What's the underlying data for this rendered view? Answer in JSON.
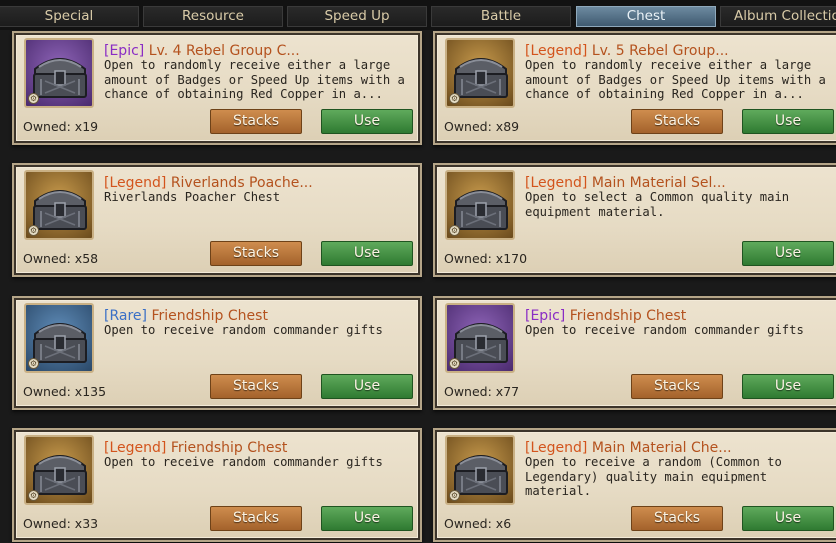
{
  "tabs": [
    "Special",
    "Resource",
    "Speed Up",
    "Battle",
    "Chest",
    "Album Collection"
  ],
  "active_tab": "Chest",
  "buttons": {
    "stacks": "Stacks",
    "use": "Use"
  },
  "items": [
    {
      "rarity": "[Epic]",
      "rarity_class": "epic",
      "name": "Lv. 4 Rebel Group C...",
      "desc": "Open to randomly receive either a large amount of Badges or Speed Up items with a chance of obtaining Red Copper in a...",
      "owned": "Owned: x19",
      "has_stacks": true,
      "icon": "chest-icon"
    },
    {
      "rarity": "[Legend]",
      "rarity_class": "legend",
      "name": "Lv. 5 Rebel Group...",
      "desc": "Open to randomly receive either a large amount of Badges or Speed Up items with a chance of obtaining Red Copper in a...",
      "owned": "Owned: x89",
      "has_stacks": true,
      "icon": "chest-icon"
    },
    {
      "rarity": "[Legend]",
      "rarity_class": "legend",
      "name": "Riverlands Poache...",
      "desc": "Riverlands Poacher Chest",
      "owned": "Owned: x58",
      "has_stacks": true,
      "icon": "chest-icon"
    },
    {
      "rarity": "[Legend]",
      "rarity_class": "legend",
      "name": "Main Material Sel...",
      "desc": "Open to select a Common quality main equipment material.",
      "owned": "Owned: x170",
      "has_stacks": false,
      "icon": "chest-icon"
    },
    {
      "rarity": "[Rare]",
      "rarity_class": "rare",
      "name": "Friendship Chest",
      "desc": "Open to receive random commander gifts",
      "owned": "Owned: x135",
      "has_stacks": true,
      "icon": "chest-icon"
    },
    {
      "rarity": "[Epic]",
      "rarity_class": "epic",
      "name": "Friendship Chest",
      "desc": "Open to receive random commander gifts",
      "owned": "Owned: x77",
      "has_stacks": true,
      "icon": "chest-icon"
    },
    {
      "rarity": "[Legend]",
      "rarity_class": "legend",
      "name": "Friendship Chest",
      "desc": "Open to receive random commander gifts",
      "owned": "Owned: x33",
      "has_stacks": true,
      "icon": "chest-icon"
    },
    {
      "rarity": "[Legend]",
      "rarity_class": "legend",
      "name": "Main Material Che...",
      "desc": "Open to receive a random (Common to Legendary) quality main equipment material.",
      "owned": "Owned: x6",
      "has_stacks": true,
      "icon": "chest-icon"
    }
  ]
}
